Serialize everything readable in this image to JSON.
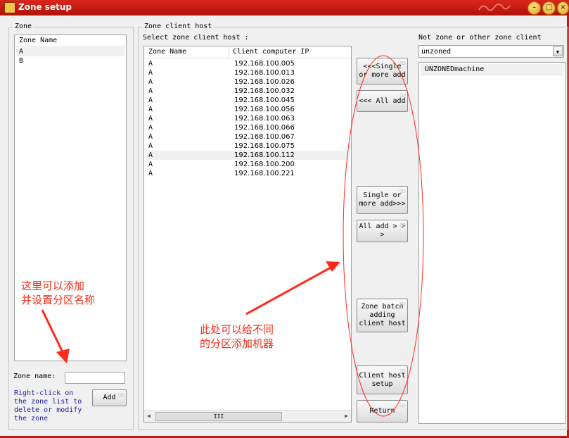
{
  "window": {
    "title": "Zone setup"
  },
  "zone": {
    "group_label": "Zone",
    "list_header": "Zone Name",
    "items": [
      "A",
      "B"
    ],
    "name_label": "Zone name:",
    "name_value": "",
    "hint": [
      "Right-click on",
      "the zone list to",
      "delete or modify",
      "the zone"
    ],
    "add_label": "Add"
  },
  "client": {
    "group_label": "Zone client host",
    "select_label": "Select zone client host :",
    "headers": [
      "Zone Name",
      "Client computer IP"
    ],
    "rows": [
      [
        "A",
        "192.168.100.005"
      ],
      [
        "A",
        "192.168.100.013"
      ],
      [
        "A",
        "192.168.100.026"
      ],
      [
        "A",
        "192.168.100.032"
      ],
      [
        "A",
        "192.168.100.045"
      ],
      [
        "A",
        "192.168.100.056"
      ],
      [
        "A",
        "192.168.100.063"
      ],
      [
        "A",
        "192.168.100.066"
      ],
      [
        "A",
        "192.168.100.067"
      ],
      [
        "A",
        "192.168.100.075"
      ],
      [
        "A",
        "192.168.100.112"
      ],
      [
        "A",
        "192.168.100.200"
      ],
      [
        "A",
        "192.168.100.221"
      ]
    ],
    "scroll_thumb": "III"
  },
  "buttons": {
    "single_add_left": [
      "<<<Single",
      "or more add"
    ],
    "all_add_left": "<<< All add",
    "single_add_right": [
      "Single or",
      "more add>>>"
    ],
    "all_add_right": [
      "All add > >",
      ">"
    ],
    "batch": [
      "Zone batch",
      "adding",
      "client host"
    ],
    "client_setup": [
      "Client host",
      "setup"
    ],
    "return": "Return"
  },
  "other": {
    "label": "Not zone or other zone client host",
    "dropdown_value": "unzoned",
    "list_items": [
      "UNZONEDmachine"
    ]
  },
  "annotations": {
    "left": [
      "这里可以添加",
      "并设置分区名称"
    ],
    "center": [
      "此处可以给不同",
      "的分区添加机器"
    ],
    "color": "#ff2a1a"
  },
  "colors": {
    "titlebar": "#c8170d",
    "accent": "#ff2a1a"
  }
}
